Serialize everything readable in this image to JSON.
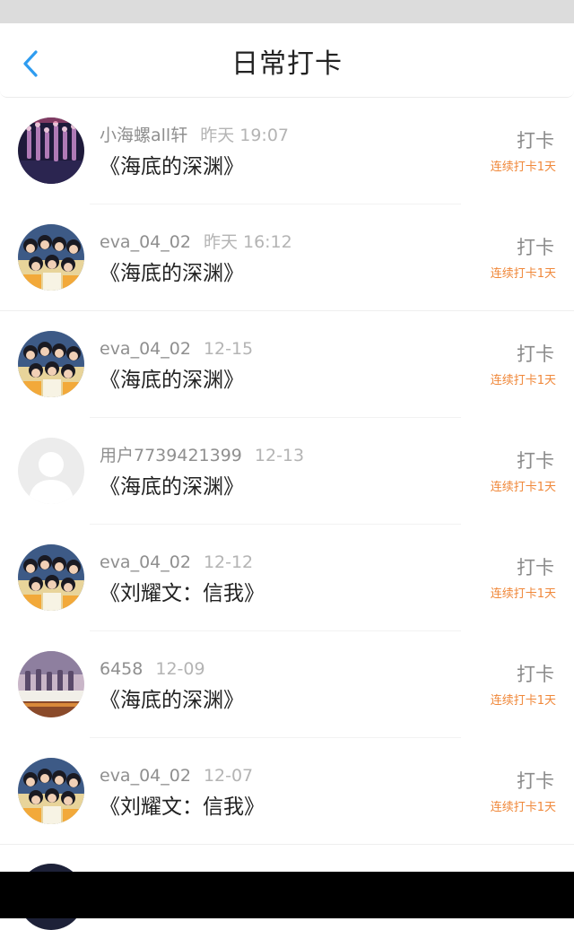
{
  "header": {
    "title": "日常打卡",
    "back_icon": "chevron-left-icon"
  },
  "colors": {
    "accent": "#2e9cf0",
    "streak": "#f0883a",
    "status_bar": "#dcdcdc",
    "nav_bar": "#000000"
  },
  "items": [
    {
      "user": "小海螺all轩",
      "time": "昨天 19:07",
      "book": "《海底的深渊》",
      "action": "打卡",
      "streak": "连续打卡1天",
      "avatar": "stage-performers-photo"
    },
    {
      "user": "eva_04_02",
      "time": "昨天 16:12",
      "book": "《海底的深渊》",
      "action": "打卡",
      "streak": "连续打卡1天",
      "avatar": "group-photo"
    },
    {
      "user": "eva_04_02",
      "time": "12-15",
      "book": "《海底的深渊》",
      "action": "打卡",
      "streak": "连续打卡1天",
      "avatar": "group-photo"
    },
    {
      "user": "用户7739421399",
      "time": "12-13",
      "book": "《海底的深渊》",
      "action": "打卡",
      "streak": "连续打卡1天",
      "avatar": "default-user-icon"
    },
    {
      "user": "eva_04_02",
      "time": "12-12",
      "book": "《刘耀文：信我》",
      "action": "打卡",
      "streak": "连续打卡1天",
      "avatar": "group-photo"
    },
    {
      "user": "6458",
      "time": "12-09",
      "book": "《海底的深渊》",
      "action": "打卡",
      "streak": "连续打卡1天",
      "avatar": "stage-photo"
    },
    {
      "user": "eva_04_02",
      "time": "12-07",
      "book": "《刘耀文：信我》",
      "action": "打卡",
      "streak": "连续打卡1天",
      "avatar": "group-photo"
    }
  ]
}
